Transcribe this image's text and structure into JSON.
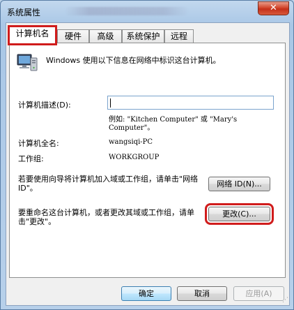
{
  "window": {
    "title": "系统属性",
    "close_label": "✕"
  },
  "tabs": [
    {
      "label": "计算机名",
      "active": true
    },
    {
      "label": "硬件",
      "active": false
    },
    {
      "label": "高级",
      "active": false
    },
    {
      "label": "系统保护",
      "active": false
    },
    {
      "label": "远程",
      "active": false
    }
  ],
  "computer_name": {
    "intro": "Windows 使用以下信息在网络中标识这台计算机。",
    "description_label": "计算机描述(D):",
    "description_value": "",
    "example_text": "例如: \"Kitchen Computer\" 或 \"Mary's Computer\"。",
    "full_name_label": "计算机全名:",
    "full_name_value": "wangsiqi-PC",
    "workgroup_label": "工作组:",
    "workgroup_value": "WORKGROUP",
    "network_text": "若要使用向导将计算机加入域或工作组，请单击\"网络 ID\"。",
    "network_id_button": "网络 ID(N)...",
    "rename_text": "要重命名这台计算机，或者更改其域或工作组，请单击\"更改\"。",
    "change_button": "更改(C)..."
  },
  "footer": {
    "ok": "确定",
    "cancel": "取消",
    "apply": "应用(A)"
  },
  "colors": {
    "highlight": "#d01c1c",
    "title_bar": "#b7d0ea",
    "close": "#c4301a"
  }
}
